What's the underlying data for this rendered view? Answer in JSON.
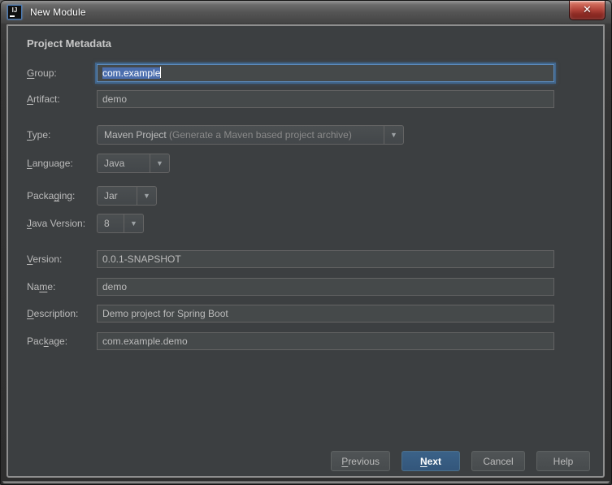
{
  "titlebar": {
    "title": "New Module",
    "app_icon_text": "IJ",
    "close_glyph": "✕"
  },
  "header": {
    "title": "Project Metadata"
  },
  "form": {
    "group": {
      "label_pre": "",
      "label_mn": "G",
      "label_post": "roup:",
      "value": "com.example",
      "state": "focused, text selected"
    },
    "artifact": {
      "label_pre": "",
      "label_mn": "A",
      "label_post": "rtifact:",
      "value": "demo"
    },
    "type": {
      "label_pre": "",
      "label_mn": "T",
      "label_post": "ype:",
      "value": "Maven Project",
      "hint": "(Generate a Maven based project archive)"
    },
    "language": {
      "label_pre": "",
      "label_mn": "L",
      "label_post": "anguage:",
      "value": "Java"
    },
    "packaging": {
      "label_pre": "Packa",
      "label_mn": "g",
      "label_post": "ing:",
      "value": "Jar"
    },
    "java_version": {
      "label_pre": "",
      "label_mn": "J",
      "label_post": "ava Version:",
      "value": "8"
    },
    "version": {
      "label_pre": "",
      "label_mn": "V",
      "label_post": "ersion:",
      "value": "0.0.1-SNAPSHOT"
    },
    "name": {
      "label_pre": "Na",
      "label_mn": "m",
      "label_post": "e:",
      "value": "demo"
    },
    "description": {
      "label_pre": "",
      "label_mn": "D",
      "label_post": "escription:",
      "value": "Demo project for Spring Boot"
    },
    "package": {
      "label_pre": "Pac",
      "label_mn": "k",
      "label_post": "age:",
      "value": "com.example.demo"
    }
  },
  "icons": {
    "chevron_down_glyph": "▼"
  },
  "buttons": {
    "previous": {
      "pre": "",
      "mn": "P",
      "post": "revious"
    },
    "next": {
      "pre": "",
      "mn": "N",
      "post": "ext"
    },
    "cancel": {
      "label": "Cancel"
    },
    "help": {
      "label": "Help"
    }
  },
  "colors": {
    "dialog_bg": "#3c3f41",
    "field_bg": "#45494a",
    "field_border": "#646464",
    "focus_ring": "#41668c",
    "selection_bg": "#4b6eae",
    "default_button_bg": "#33567b",
    "close_button_red": "#b5473c",
    "label_text": "#bbbbbb"
  }
}
